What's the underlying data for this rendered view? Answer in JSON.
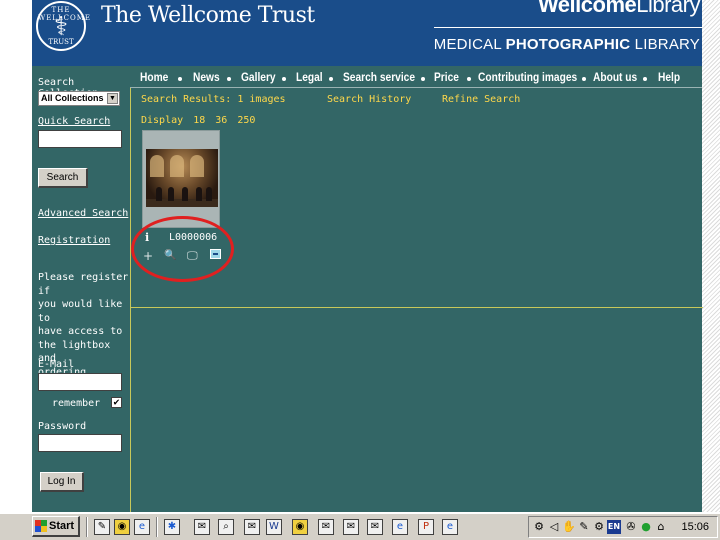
{
  "header": {
    "logo_ring_top": "THE WELLCOME",
    "logo_ring_bottom": "TRUST",
    "logo_symbol": "⚕",
    "title": "The Wellcome Trust",
    "library_logo_bold": "Wellcome",
    "library_logo_light": "Library",
    "section_prefix": "MEDICAL ",
    "section_bold": "PHOTOGRAPHIC",
    "section_suffix": " LIBRARY"
  },
  "nav": {
    "items": [
      "Home",
      "News",
      "Gallery",
      "Legal",
      "Search service",
      "Price",
      "Contributing images",
      "About us",
      "Help"
    ]
  },
  "sidebar": {
    "search_collection_label": "Search Collection",
    "collection_value": "All Collections",
    "quick_search_label": "Quick Search",
    "search_button": "Search",
    "advanced_search_link": "Advanced Search",
    "registration_link": "Registration",
    "register_note": "Please register if\nyou would like to\nhave access to\nthe lightbox and\nordering facilities.",
    "email_label": "E-Mail",
    "remember_label": "remember",
    "remember_checked": "✔",
    "password_label": "Password",
    "login_button": "Log In"
  },
  "results": {
    "summary_label": "Search Results:",
    "count": "1",
    "unit": "images",
    "history_link": "Search History",
    "refine_link": "Refine Search",
    "display_label": "Display",
    "display_options": [
      "18",
      "36",
      "250"
    ]
  },
  "item": {
    "info_icon": "i",
    "id": "L0000006",
    "action_icons": [
      "+",
      "🔍",
      "🖵"
    ]
  },
  "taskbar": {
    "start_label": "Start",
    "clock": "15:06"
  },
  "colors": {
    "header_blue": "#1a4d8a",
    "panel_teal": "#336666",
    "results_yellow": "#ffd84a",
    "annotation_red": "#e02020"
  }
}
